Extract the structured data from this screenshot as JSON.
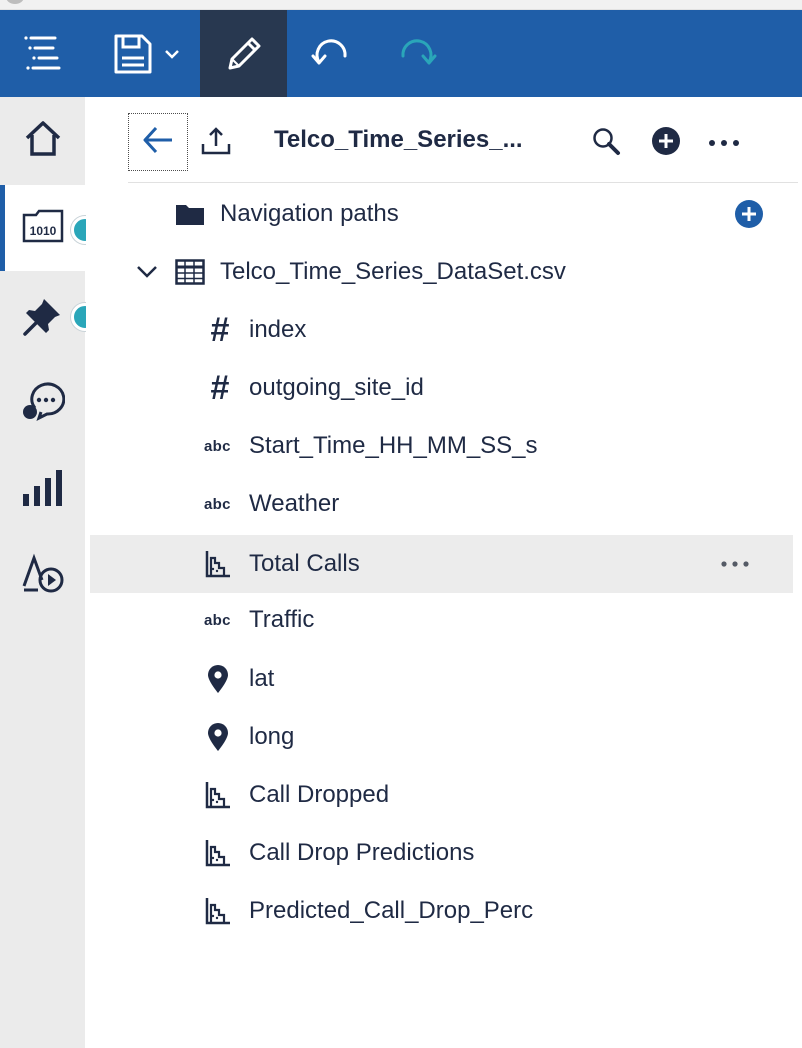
{
  "toolbar": {
    "menu_icon": "menu-stack-icon",
    "save_icon": "save-icon",
    "edit_icon": "pencil-icon",
    "undo_icon": "undo-icon",
    "redo_icon": "redo-icon",
    "bar_color": "#1f5ea8",
    "active_color": "#283850"
  },
  "rail": {
    "items": [
      {
        "icon": "home-icon"
      },
      {
        "icon": "data-source-icon",
        "selected": true,
        "badge": true
      },
      {
        "icon": "pin-icon",
        "badge": true
      },
      {
        "icon": "conversation-icon"
      },
      {
        "icon": "bar-chart-icon"
      },
      {
        "icon": "story-play-icon"
      }
    ],
    "badge_color": "#2aa6b9"
  },
  "panel": {
    "title": "Telco_Time_Series_...",
    "navigation_paths_label": "Navigation paths",
    "dataset_label": "Telco_Time_Series_DataSet.csv",
    "fields": [
      {
        "label": "index",
        "type": "#"
      },
      {
        "label": "outgoing_site_id",
        "type": "#"
      },
      {
        "label": "Start_Time_HH_MM_SS_s",
        "type": "abc"
      },
      {
        "label": "Weather",
        "type": "abc"
      },
      {
        "label": "Total Calls",
        "type": "measure",
        "highlighted": true
      },
      {
        "label": "Traffic",
        "type": "abc"
      },
      {
        "label": "lat",
        "type": "geo"
      },
      {
        "label": "long",
        "type": "geo"
      },
      {
        "label": "Call Dropped",
        "type": "measure"
      },
      {
        "label": "Call Drop Predictions",
        "type": "measure"
      },
      {
        "label": "Predicted_Call_Drop_Perc",
        "type": "measure"
      }
    ],
    "abc_text": "abc",
    "hash_text": "#"
  }
}
